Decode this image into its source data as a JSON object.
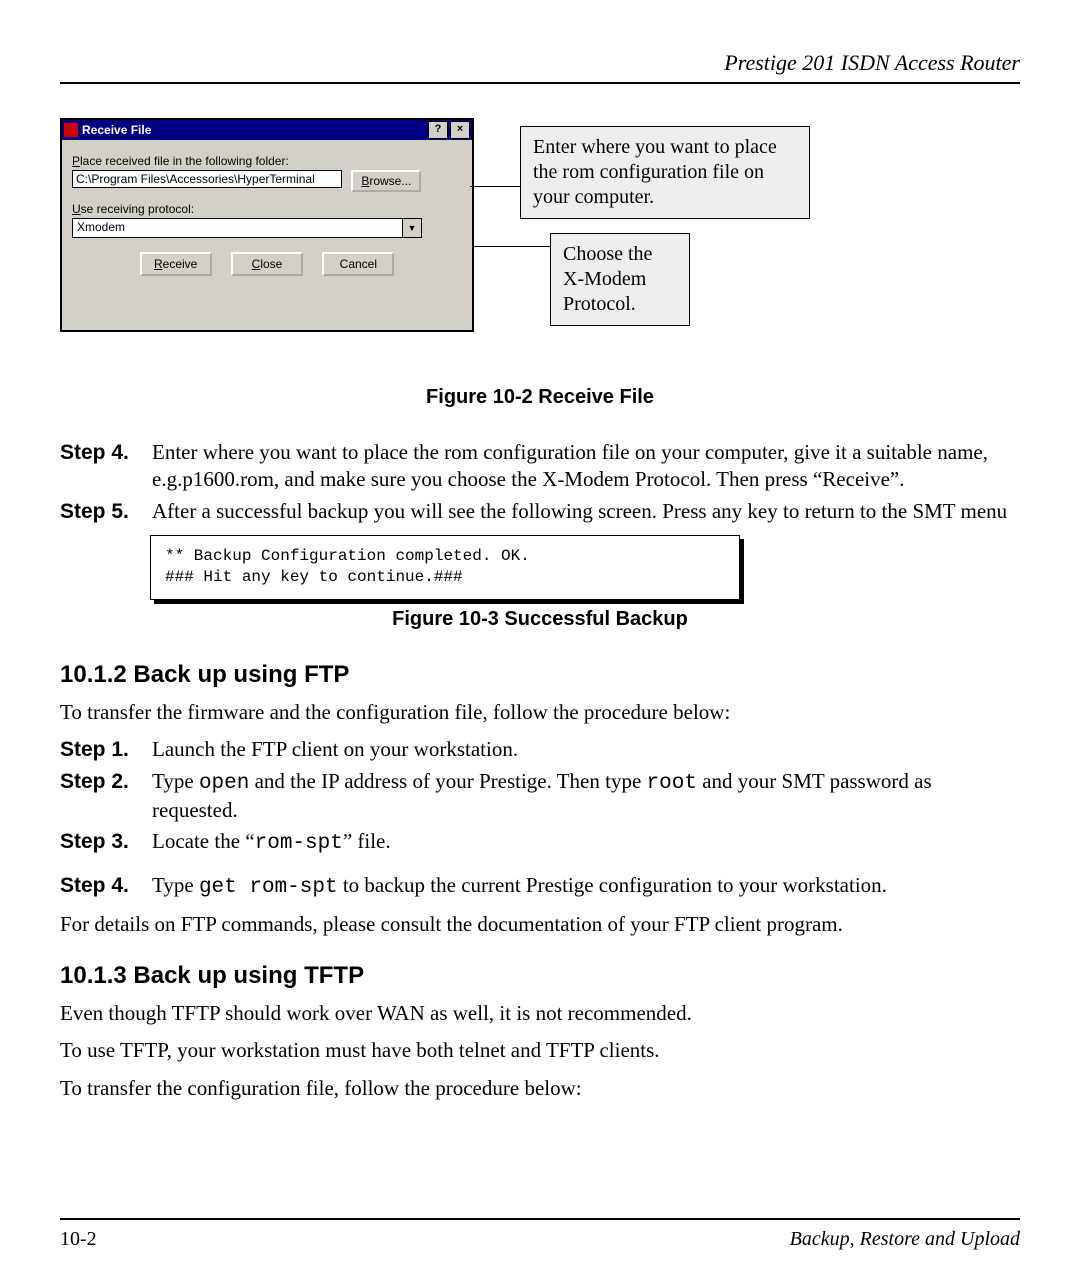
{
  "header": {
    "running_title": "Prestige 201 ISDN Access Router"
  },
  "dialog": {
    "title": "Receive File",
    "help_glyph": "?",
    "close_glyph": "×",
    "label_folder_pre": "P",
    "label_folder_rest": "lace received file in the following folder:",
    "path_value": "C:\\Program Files\\Accessories\\HyperTerminal",
    "browse_label": "Browse...",
    "label_protocol_pre": "U",
    "label_protocol_rest": "se receiving protocol:",
    "protocol_value": "Xmodem",
    "dropdown_glyph": "▼",
    "btn_receive": "Receive",
    "btn_close": "Close",
    "btn_cancel": "Cancel"
  },
  "callouts": {
    "place_file": "Enter where you want to place the rom configuration file on your computer.",
    "protocol": "Choose the X-Modem Protocol."
  },
  "captions": {
    "fig_10_2": "Figure 10-2 Receive File",
    "fig_10_3": "Figure 10-3 Successful Backup"
  },
  "steps_a": {
    "s4_label": "Step 4.",
    "s4_text": "Enter where you want to place the rom configuration file on your computer, give it a suitable name, e.g.p1600.rom, and make sure you choose the X-Modem Protocol. Then press “Receive”.",
    "s5_label": "Step 5.",
    "s5_text": "After a successful backup you will see the following screen. Press any key to return to the SMT menu"
  },
  "terminal": {
    "line1": "** Backup Configuration completed. OK.",
    "line2": "### Hit any key to continue.###"
  },
  "section_ftp": {
    "heading": "10.1.2 Back up using FTP",
    "intro": "To transfer the firmware and the configuration file, follow the procedure below:",
    "s1_label": "Step 1.",
    "s1_text": "Launch the FTP client on your workstation.",
    "s2_label": "Step 2.",
    "s2_pre": "Type ",
    "s2_code1": "open",
    "s2_mid": " and the IP address of your Prestige. Then type ",
    "s2_code2": "root",
    "s2_post": " and your SMT password as requested.",
    "s3_label": "Step 3.",
    "s3_pre": "Locate the “",
    "s3_code": "rom-spt",
    "s3_post": "” file.",
    "s4_label": "Step 4.",
    "s4_pre": "Type ",
    "s4_code": "get rom-spt",
    "s4_post": " to backup the current Prestige configuration to your workstation.",
    "outro": "For details on FTP commands, please consult the documentation of your FTP client program."
  },
  "section_tftp": {
    "heading": "10.1.3 Back up using TFTP",
    "p1": "Even though TFTP should work over WAN as well, it is not recommended.",
    "p2": "To use TFTP, your workstation must have both telnet and TFTP clients.",
    "p3": "To transfer the configuration file, follow the procedure below:"
  },
  "footer": {
    "page": "10-2",
    "title": "Backup, Restore and Upload"
  }
}
